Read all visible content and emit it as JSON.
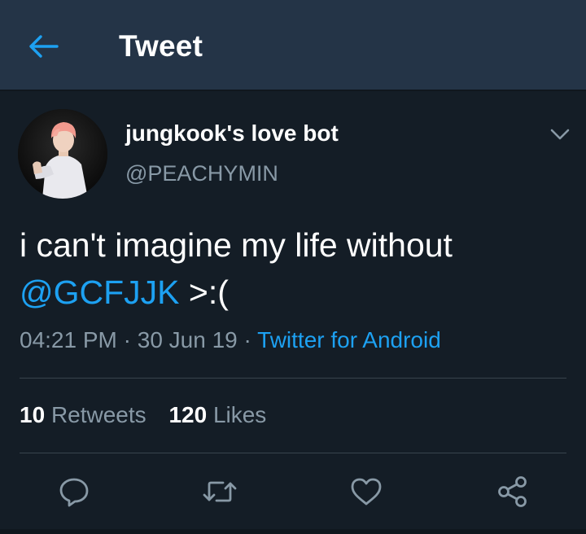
{
  "header": {
    "title": "Tweet",
    "back_icon": "arrow-left-icon"
  },
  "tweet": {
    "display_name": "jungkook's love bot",
    "handle": "@PEACHYMIN",
    "text_before": "i can't imagine my life without",
    "mention": "@GCFJJK",
    "text_after": " >:(",
    "time": "04:21 PM",
    "date": "30 Jun 19",
    "source": "Twitter for Android",
    "separator": " · "
  },
  "stats": {
    "retweets_count": "10",
    "retweets_label": "Retweets",
    "likes_count": "120",
    "likes_label": "Likes"
  },
  "actions": {
    "reply_icon": "reply-icon",
    "retweet_icon": "retweet-icon",
    "like_icon": "heart-icon",
    "share_icon": "share-icon"
  },
  "colors": {
    "background": "#141d26",
    "header": "#243447",
    "accent": "#1da1f2",
    "secondary_text": "#8899a6",
    "primary_text": "#ffffff"
  }
}
